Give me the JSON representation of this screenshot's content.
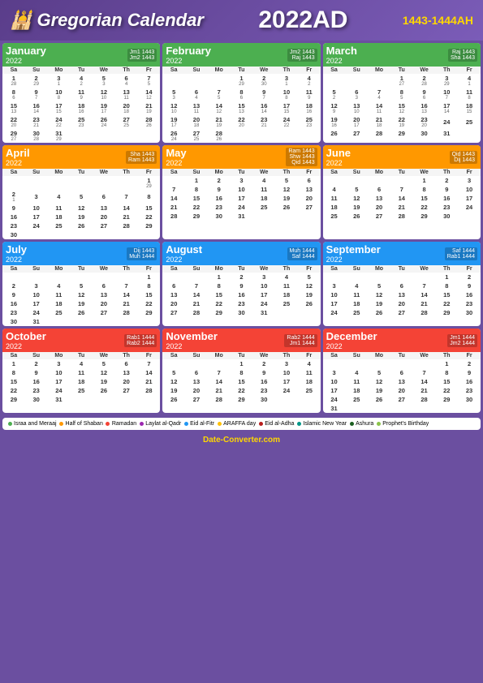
{
  "header": {
    "title": "Gregorian Calendar",
    "year": "2022AD",
    "hijri": "1443-1444AH"
  },
  "months": [
    {
      "name": "January",
      "year": "2022",
      "class": "month-jan",
      "hijri1": "Jm1 1443",
      "hijri2": "Jm2 1443",
      "days_header": [
        "Sa",
        "Su",
        "Mo",
        "Tu",
        "We",
        "Th",
        "Fr"
      ],
      "weeks": [
        [
          null,
          null,
          null,
          null,
          null,
          null,
          null
        ],
        [
          "1",
          "2",
          "3",
          "4",
          "5",
          "6",
          "7"
        ],
        [
          "8",
          "9",
          "10",
          "11",
          "12",
          "13",
          "14"
        ],
        [
          "15",
          "16",
          "17",
          "18",
          "19",
          "20",
          "21"
        ],
        [
          "22",
          "23",
          "24",
          "25",
          "26",
          "27",
          "28"
        ],
        [
          "29",
          "30",
          "31",
          null,
          null,
          null,
          null
        ]
      ]
    },
    {
      "name": "February",
      "year": "2022",
      "class": "month-feb",
      "hijri1": "Jm2 1443",
      "hijri2": "Raj 1443",
      "days_header": [
        "Sa",
        "Su",
        "Mo",
        "Tu",
        "We",
        "Th",
        "Fr"
      ],
      "weeks": [
        [
          null,
          null,
          null,
          "1",
          "2",
          "3",
          "4"
        ],
        [
          "5",
          "6",
          "7",
          "8",
          "9",
          "10",
          "11"
        ],
        [
          "12",
          "13",
          "14",
          "15",
          "16",
          "17",
          "18"
        ],
        [
          "19",
          "20",
          "21",
          "22",
          "23",
          "24",
          "25"
        ],
        [
          "26",
          "27",
          "28",
          null,
          null,
          null,
          null
        ]
      ]
    },
    {
      "name": "March",
      "year": "2022",
      "class": "month-mar",
      "hijri1": "Raj 1443",
      "hijri2": "Sha 1443",
      "days_header": [
        "Sa",
        "Su",
        "Mo",
        "Tu",
        "We",
        "Th",
        "Fr"
      ],
      "weeks": [
        [
          null,
          null,
          null,
          "1",
          "2",
          "3",
          "4"
        ],
        [
          "5",
          "6",
          "7",
          "8",
          "9",
          "10",
          "11"
        ],
        [
          "12",
          "13",
          "14",
          "15",
          "16",
          "17",
          "18"
        ],
        [
          "19",
          "20",
          "21",
          "22",
          "23",
          "24",
          "25"
        ],
        [
          "26",
          "27",
          "28",
          "29",
          "30",
          "31",
          null
        ]
      ]
    },
    {
      "name": "April",
      "year": "2022",
      "class": "month-apr",
      "hijri1": "Sha 1443",
      "hijri2": "Ram 1443",
      "days_header": [
        "Sa",
        "Su",
        "Mo",
        "Tu",
        "We",
        "Th",
        "Fr"
      ],
      "weeks": [
        [
          null,
          null,
          null,
          null,
          null,
          null,
          "1"
        ],
        [
          "2",
          "3",
          "4",
          "5",
          "6",
          "7",
          "8"
        ],
        [
          "9",
          "10",
          "11",
          "12",
          "13",
          "14",
          "15"
        ],
        [
          "16",
          "17",
          "18",
          "19",
          "20",
          "21",
          "22"
        ],
        [
          "23",
          "24",
          "25",
          "26",
          "27",
          "28",
          "29"
        ],
        [
          "30",
          null,
          null,
          null,
          null,
          null,
          null
        ]
      ]
    },
    {
      "name": "May",
      "year": "2022",
      "class": "month-may",
      "hijri1": "Ram 1443",
      "hijri2": "Shw 1443",
      "hijri3": "Qid 1443",
      "days_header": [
        "Sa",
        "Su",
        "Mo",
        "Tu",
        "We",
        "Th",
        "Fr"
      ],
      "weeks": [
        [
          null,
          "1",
          "2",
          "3",
          "4",
          "5",
          "6"
        ],
        [
          "7",
          "8",
          "9",
          "10",
          "11",
          "12",
          "13"
        ],
        [
          "14",
          "15",
          "16",
          "17",
          "18",
          "19",
          "20"
        ],
        [
          "21",
          "22",
          "23",
          "24",
          "25",
          "26",
          "27"
        ],
        [
          "28",
          "29",
          "30",
          "31",
          null,
          null,
          null
        ]
      ]
    },
    {
      "name": "June",
      "year": "2022",
      "class": "month-jun",
      "hijri1": "Qid 1443",
      "hijri2": "Dij 1443",
      "days_header": [
        "Sa",
        "Su",
        "Mo",
        "Tu",
        "We",
        "Th",
        "Fr"
      ],
      "weeks": [
        [
          null,
          null,
          null,
          null,
          "1",
          "2",
          "3"
        ],
        [
          "4",
          "5",
          "6",
          "7",
          "8",
          "9",
          "10"
        ],
        [
          "11",
          "12",
          "13",
          "14",
          "15",
          "16",
          "17"
        ],
        [
          "18",
          "19",
          "20",
          "21",
          "22",
          "23",
          "24"
        ],
        [
          "25",
          "26",
          "27",
          "28",
          "29",
          "30",
          null
        ]
      ]
    },
    {
      "name": "July",
      "year": "2022",
      "class": "month-jul",
      "hijri1": "Dij 1443",
      "hijri2": "Muh 1444",
      "days_header": [
        "Sa",
        "Su",
        "Mo",
        "Tu",
        "We",
        "Th",
        "Fr"
      ],
      "weeks": [
        [
          null,
          null,
          null,
          null,
          null,
          null,
          "1"
        ],
        [
          "2",
          "3",
          "4",
          "5",
          "6",
          "7",
          "8"
        ],
        [
          "9",
          "10",
          "11",
          "12",
          "13",
          "14",
          "15"
        ],
        [
          "16",
          "17",
          "18",
          "19",
          "20",
          "21",
          "22"
        ],
        [
          "23",
          "24",
          "25",
          "26",
          "27",
          "28",
          "29"
        ],
        [
          "30",
          "31",
          null,
          null,
          null,
          null,
          null
        ]
      ]
    },
    {
      "name": "August",
      "year": "2022",
      "class": "month-aug",
      "hijri1": "Muh 1444",
      "hijri2": "Saf 1444",
      "days_header": [
        "Sa",
        "Su",
        "Mo",
        "Tu",
        "We",
        "Th",
        "Fr"
      ],
      "weeks": [
        [
          null,
          null,
          "1",
          "2",
          "3",
          "4",
          "5"
        ],
        [
          "6",
          "7",
          "8",
          "9",
          "10",
          "11",
          "12"
        ],
        [
          "13",
          "14",
          "15",
          "16",
          "17",
          "18",
          "19"
        ],
        [
          "20",
          "21",
          "22",
          "23",
          "24",
          "25",
          "26"
        ],
        [
          "27",
          "28",
          "29",
          "30",
          "31",
          null,
          null
        ]
      ]
    },
    {
      "name": "September",
      "year": "2022",
      "class": "month-sep",
      "hijri1": "Saf 1444",
      "hijri2": "Rab1 1444",
      "days_header": [
        "Sa",
        "Su",
        "Mo",
        "Tu",
        "We",
        "Th",
        "Fr"
      ],
      "weeks": [
        [
          null,
          null,
          null,
          null,
          null,
          "1",
          "2"
        ],
        [
          "3",
          "4",
          "5",
          "6",
          "7",
          "8",
          "9"
        ],
        [
          "10",
          "11",
          "12",
          "13",
          "14",
          "15",
          "16"
        ],
        [
          "17",
          "18",
          "19",
          "20",
          "21",
          "22",
          "23"
        ],
        [
          "24",
          "25",
          "26",
          "27",
          "28",
          "29",
          "30"
        ]
      ]
    },
    {
      "name": "October",
      "year": "2022",
      "class": "month-oct",
      "hijri1": "Rab1 1444",
      "hijri2": "Rab2 1444",
      "days_header": [
        "Sa",
        "Su",
        "Mo",
        "Tu",
        "We",
        "Th",
        "Fr"
      ],
      "weeks": [
        [
          "1",
          "2",
          "3",
          "4",
          "5",
          "6",
          "7"
        ],
        [
          "8",
          "9",
          "10",
          "11",
          "12",
          "13",
          "14"
        ],
        [
          "15",
          "16",
          "17",
          "18",
          "19",
          "20",
          "21"
        ],
        [
          "22",
          "23",
          "24",
          "25",
          "26",
          "27",
          "28"
        ],
        [
          "29",
          "30",
          "31",
          null,
          null,
          null,
          null
        ]
      ]
    },
    {
      "name": "November",
      "year": "2022",
      "class": "month-nov",
      "hijri1": "Rab2 1444",
      "hijri2": "Jm1 1444",
      "days_header": [
        "Sa",
        "Su",
        "Mo",
        "Tu",
        "We",
        "Th",
        "Fr"
      ],
      "weeks": [
        [
          null,
          null,
          null,
          "1",
          "2",
          "3",
          "4"
        ],
        [
          "5",
          "6",
          "7",
          "8",
          "9",
          "10",
          "11"
        ],
        [
          "12",
          "13",
          "14",
          "15",
          "16",
          "17",
          "18"
        ],
        [
          "19",
          "20",
          "21",
          "22",
          "23",
          "24",
          "25"
        ],
        [
          "26",
          "27",
          "28",
          "29",
          "30",
          null,
          null
        ]
      ]
    },
    {
      "name": "December",
      "year": "2022",
      "class": "month-dec",
      "hijri1": "Jm1 1444",
      "hijri2": "Jm2 1444",
      "days_header": [
        "Sa",
        "Su",
        "Mo",
        "Tu",
        "We",
        "Th",
        "Fr"
      ],
      "weeks": [
        [
          null,
          null,
          null,
          null,
          null,
          "1",
          "2"
        ],
        [
          "3",
          "4",
          "5",
          "6",
          "7",
          "8",
          "9"
        ],
        [
          "10",
          "11",
          "12",
          "13",
          "14",
          "15",
          "16"
        ],
        [
          "17",
          "18",
          "19",
          "20",
          "21",
          "22",
          "23"
        ],
        [
          "24",
          "25",
          "26",
          "27",
          "28",
          "29",
          "30"
        ],
        [
          "31",
          null,
          null,
          null,
          null,
          null,
          null
        ]
      ]
    }
  ],
  "legend": [
    {
      "color": "green",
      "label": "Israa and Meraaj"
    },
    {
      "color": "orange",
      "label": "Half of Shaban"
    },
    {
      "color": "red",
      "label": "Ramadan"
    },
    {
      "color": "purple",
      "label": "Laylat al-Qadr"
    },
    {
      "color": "blue",
      "label": "Eid al-Fitr"
    },
    {
      "color": "yellow",
      "label": "ARAFFA day"
    },
    {
      "color": "darkred",
      "label": "Eid al-Adha"
    },
    {
      "color": "teal",
      "label": "Islamic New Year"
    },
    {
      "color": "darkgreen",
      "label": "Ashura"
    },
    {
      "color": "lime",
      "label": "Prophet's Birthday"
    }
  ],
  "website": "Date-Converter.com"
}
